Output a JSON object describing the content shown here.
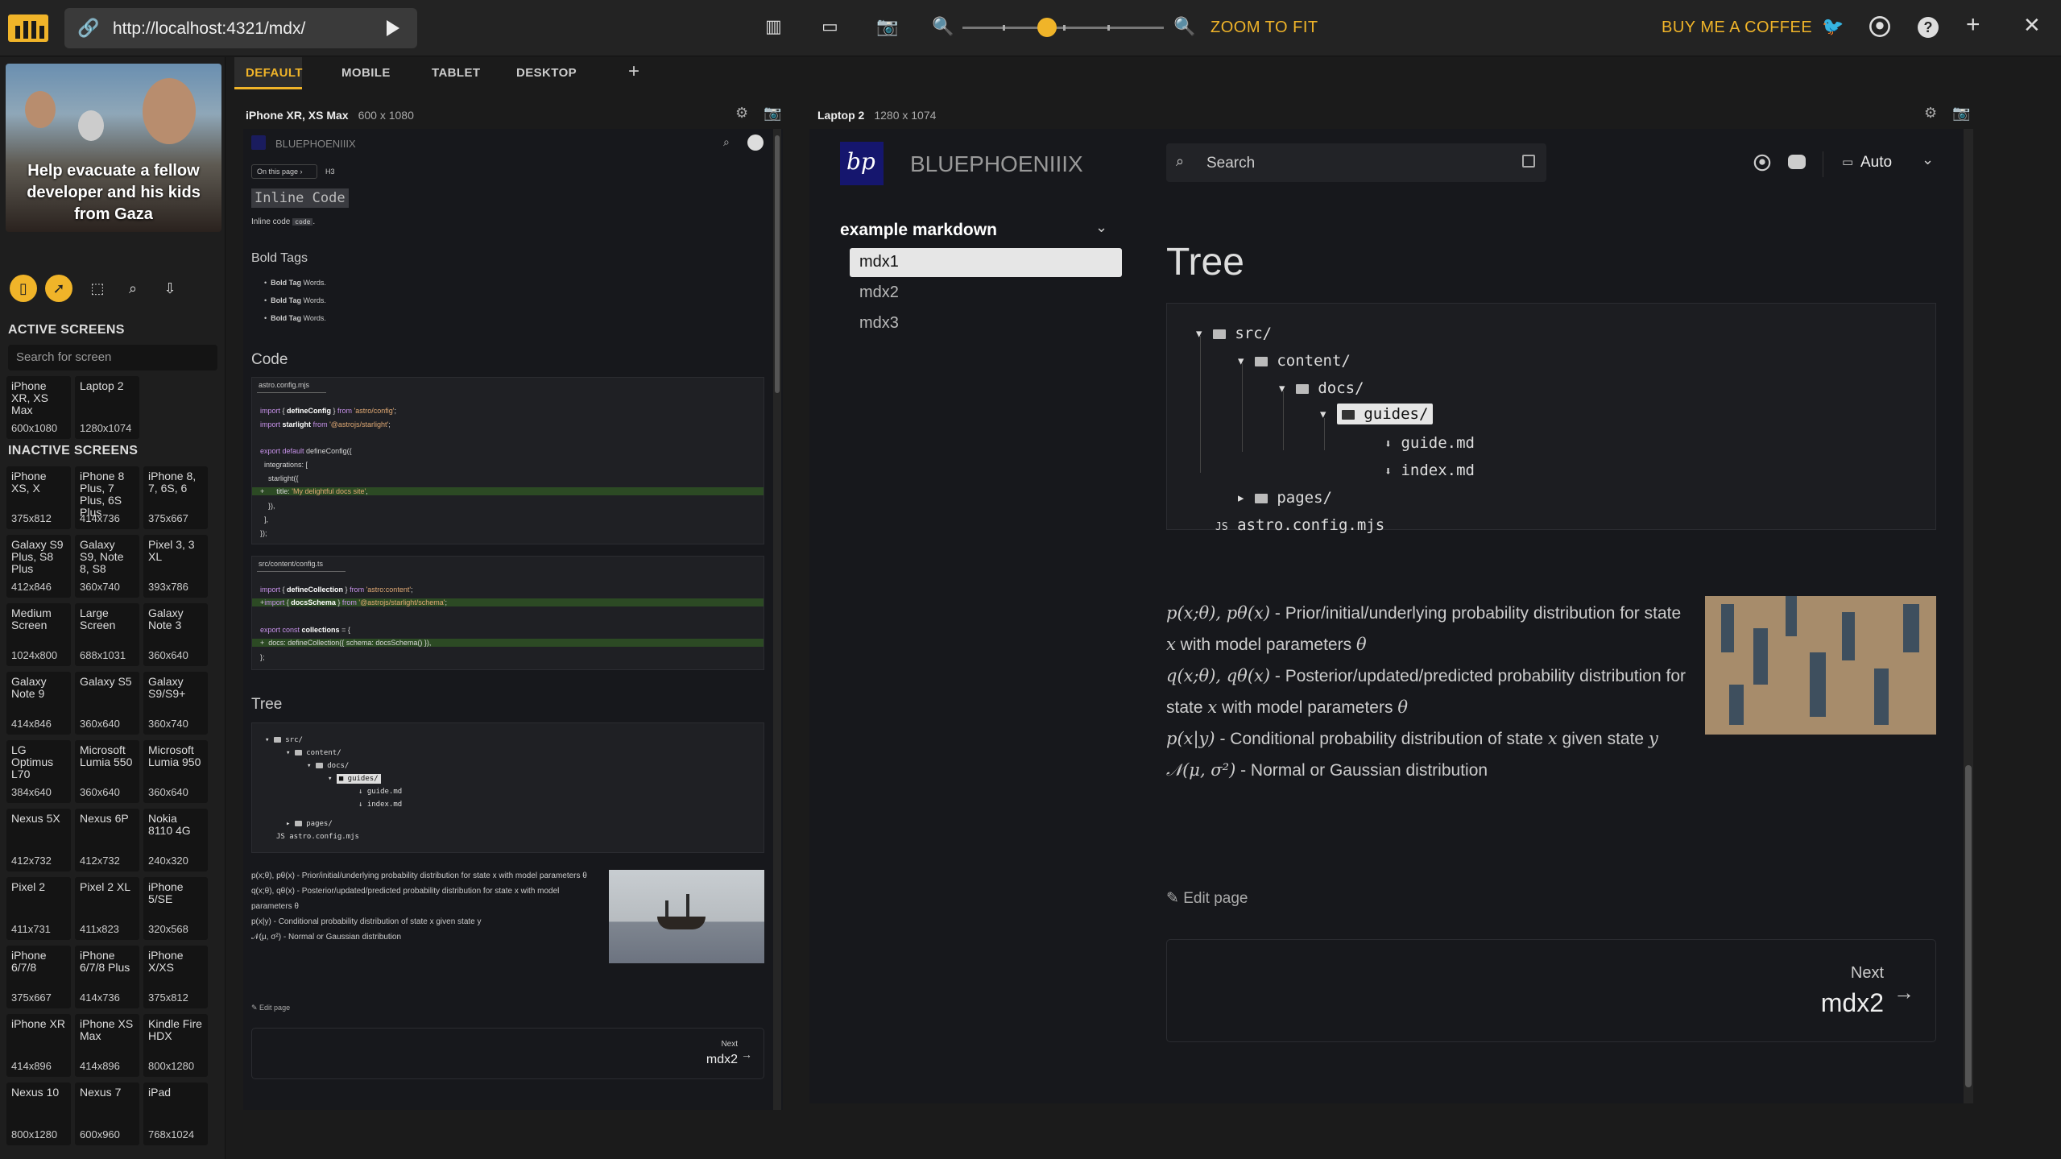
{
  "topbar": {
    "url": "http://localhost:4321/mdx/",
    "zoom_label": "ZOOM TO FIT",
    "coffee_label": "BUY ME A COFFEE",
    "zoom_level": 0.42
  },
  "sidebar": {
    "banner_text": "Help evacuate a fellow developer and his kids from Gaza",
    "active_title": "ACTIVE SCREENS",
    "search_placeholder": "Search for screen",
    "inactive_title": "INACTIVE SCREENS",
    "active": [
      {
        "name": "iPhone XR, XS Max",
        "size": "600x1080"
      },
      {
        "name": "Laptop 2",
        "size": "1280x1074"
      }
    ],
    "inactive": [
      {
        "name": "iPhone XS, X",
        "size": "375x812"
      },
      {
        "name": "iPhone 8 Plus, 7 Plus, 6S Plus",
        "size": "414x736"
      },
      {
        "name": "iPhone 8, 7, 6S, 6",
        "size": "375x667"
      },
      {
        "name": "Galaxy S9 Plus, S8 Plus",
        "size": "412x846"
      },
      {
        "name": "Galaxy S9, Note 8, S8",
        "size": "360x740"
      },
      {
        "name": "Pixel 3, 3 XL",
        "size": "393x786"
      },
      {
        "name": "Medium Screen",
        "size": "1024x800"
      },
      {
        "name": "Large Screen",
        "size": "688x1031"
      },
      {
        "name": "Galaxy Note 3",
        "size": "360x640"
      },
      {
        "name": "Galaxy Note 9",
        "size": "414x846"
      },
      {
        "name": "Galaxy S5",
        "size": "360x640"
      },
      {
        "name": "Galaxy S9/S9+",
        "size": "360x740"
      },
      {
        "name": "LG Optimus L70",
        "size": "384x640"
      },
      {
        "name": "Microsoft Lumia 550",
        "size": "360x640"
      },
      {
        "name": "Microsoft Lumia 950",
        "size": "360x640"
      },
      {
        "name": "Nexus 5X",
        "size": "412x732"
      },
      {
        "name": "Nexus 6P",
        "size": "412x732"
      },
      {
        "name": "Nokia 8110 4G",
        "size": "240x320"
      },
      {
        "name": "Pixel 2",
        "size": "411x731"
      },
      {
        "name": "Pixel 2 XL",
        "size": "411x823"
      },
      {
        "name": "iPhone 5/SE",
        "size": "320x568"
      },
      {
        "name": "iPhone 6/7/8",
        "size": "375x667"
      },
      {
        "name": "iPhone 6/7/8 Plus",
        "size": "414x736"
      },
      {
        "name": "iPhone X/XS",
        "size": "375x812"
      },
      {
        "name": "iPhone XR",
        "size": "414x896"
      },
      {
        "name": "iPhone XS Max",
        "size": "414x896"
      },
      {
        "name": "Kindle Fire HDX",
        "size": "800x1280"
      },
      {
        "name": "Nexus 10",
        "size": "800x1280"
      },
      {
        "name": "Nexus 7",
        "size": "600x960"
      },
      {
        "name": "iPad",
        "size": "768x1024"
      }
    ]
  },
  "tabs": [
    "DEFAULT",
    "MOBILE",
    "TABLET",
    "DESKTOP"
  ],
  "phone": {
    "title": "iPhone XR, XS Max",
    "res": "600 x 1080",
    "site": "BLUEPHOENIIIX",
    "on_this_page": "On this page",
    "h3": "H3",
    "inline_heading": "Inline Code",
    "inline_text": "Inline code",
    "inline_chip": "code",
    "bold_heading": "Bold Tags",
    "bold_items": [
      "Bold Tag",
      "Bold Tag",
      "Bold Tag"
    ],
    "bold_suffix": "Words.",
    "code_heading": "Code",
    "file1": "astro.config.mjs",
    "file2": "src/content/config.ts",
    "tree_heading": "Tree",
    "math_lines": [
      "p(x;θ), pθ(x) - Prior/initial/underlying probability distribution for state x with model parameters θ",
      "q(x;θ), qθ(x) - Posterior/updated/predicted probability distribution for state x with model parameters θ",
      "p(x|y) - Conditional probability distribution of state x given state y",
      "𝒩(μ, σ²) - Normal or Gaussian distribution"
    ],
    "edit": "Edit page",
    "next_label": "Next",
    "next_title": "mdx2"
  },
  "laptop": {
    "title": "Laptop 2",
    "res": "1280 x 1074",
    "site": "BLUEPHOENIIIX",
    "search": "Search",
    "theme": "Auto",
    "nav_group": "example markdown",
    "nav_items": [
      "mdx1",
      "mdx2",
      "mdx3"
    ],
    "page_title": "Tree",
    "tree": [
      "src/",
      "content/",
      "docs/",
      "guides/",
      "guide.md",
      "index.md",
      "pages/",
      "astro.config.mjs"
    ],
    "math": [
      {
        "expr": "p(x;θ), pθ(x)",
        "text": " - Prior/initial/underlying probability distribution for state ",
        "v": "x",
        "tail": " with model parameters ",
        "t": "θ"
      },
      {
        "expr": "q(x;θ), qθ(x)",
        "text": " - Posterior/updated/predicted probability distribution for state ",
        "v": "x",
        "tail": " with model parameters ",
        "t": "θ"
      },
      {
        "expr": "p(x|y)",
        "text": " - Conditional probability distribution of state ",
        "v": "x",
        "tail": " given state ",
        "t": "y"
      },
      {
        "expr": "𝒩(μ, σ²)",
        "text": " - Normal or Gaussian distribution",
        "v": "",
        "tail": "",
        "t": ""
      }
    ],
    "edit": "Edit page",
    "next_label": "Next",
    "next_title": "mdx2"
  },
  "colors": {
    "accent": "#f0b429",
    "page_bg": "#17181c",
    "app_bg": "#1b1b1b"
  }
}
